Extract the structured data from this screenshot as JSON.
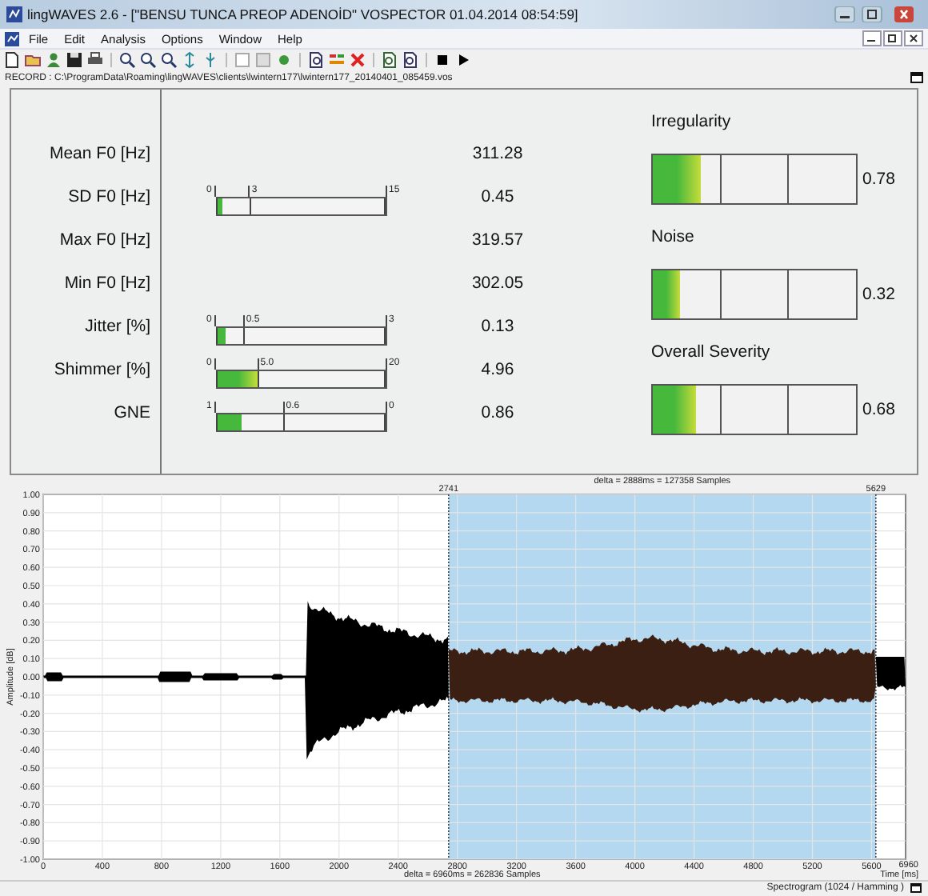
{
  "window": {
    "title": "lingWAVES 2.6 - [\"BENSU TUNCA PREOP ADENOİD\" VOSPECTOR  01.04.2014 08:54:59]"
  },
  "menu": [
    "File",
    "Edit",
    "Analysis",
    "Options",
    "Window",
    "Help"
  ],
  "record_path": "RECORD : C:\\ProgramData\\Roaming\\lingWAVES\\clients\\lwintern177\\lwintern177_20140401_085459.vos",
  "parameters": [
    {
      "label": "Mean F0 [Hz]",
      "value": "311.28"
    },
    {
      "label": "SD F0 [Hz]",
      "value": "0.45",
      "meter": {
        "scale": [
          "0",
          "3",
          "15"
        ],
        "level": 0.03
      }
    },
    {
      "label": "Max F0 [Hz]",
      "value": "319.57"
    },
    {
      "label": "Min F0 [Hz]",
      "value": "302.05"
    },
    {
      "label": "Jitter [%]",
      "value": "0.13",
      "meter": {
        "scale": [
          "0",
          "0.5",
          "3"
        ],
        "level": 0.05
      }
    },
    {
      "label": "Shimmer [%]",
      "value": "4.96",
      "meter": {
        "scale": [
          "0",
          "5.0",
          "20"
        ],
        "level": 0.25
      }
    },
    {
      "label": "GNE",
      "value": "0.86",
      "meter": {
        "scale": [
          "1",
          "0.6",
          "0"
        ],
        "level": 0.14
      }
    }
  ],
  "severity": [
    {
      "label": "Irregularity",
      "value": "0.78",
      "level": 0.24
    },
    {
      "label": "Noise",
      "value": "0.32",
      "level": 0.13
    },
    {
      "label": "Overall Severity",
      "value": "0.68",
      "level": 0.21
    }
  ],
  "waveform": {
    "selection_delta": "delta = 2888ms = 127358 Samples",
    "selection_start": "2741",
    "selection_end": "5629",
    "y_axis_title": "Amplitude [dB]",
    "y_ticks": [
      "1.00",
      "0.90",
      "0.80",
      "0.70",
      "0.60",
      "0.50",
      "0.40",
      "0.30",
      "0.20",
      "0.10",
      "0.00",
      "-0.10",
      "-0.20",
      "-0.30",
      "-0.40",
      "-0.50",
      "-0.60",
      "-0.70",
      "-0.80",
      "-0.90",
      "-1.00"
    ],
    "x_ticks": [
      "0",
      "400",
      "800",
      "1200",
      "1600",
      "2000",
      "2400",
      "2800",
      "3200",
      "3600",
      "4000",
      "4400",
      "4800",
      "5200",
      "5600"
    ],
    "x_end": "6960",
    "x_axis_title": "Time [ms]",
    "total_delta": "delta = 6960ms = 262836 Samples"
  },
  "status": "Spectrogram (1024 / Hamming )"
}
